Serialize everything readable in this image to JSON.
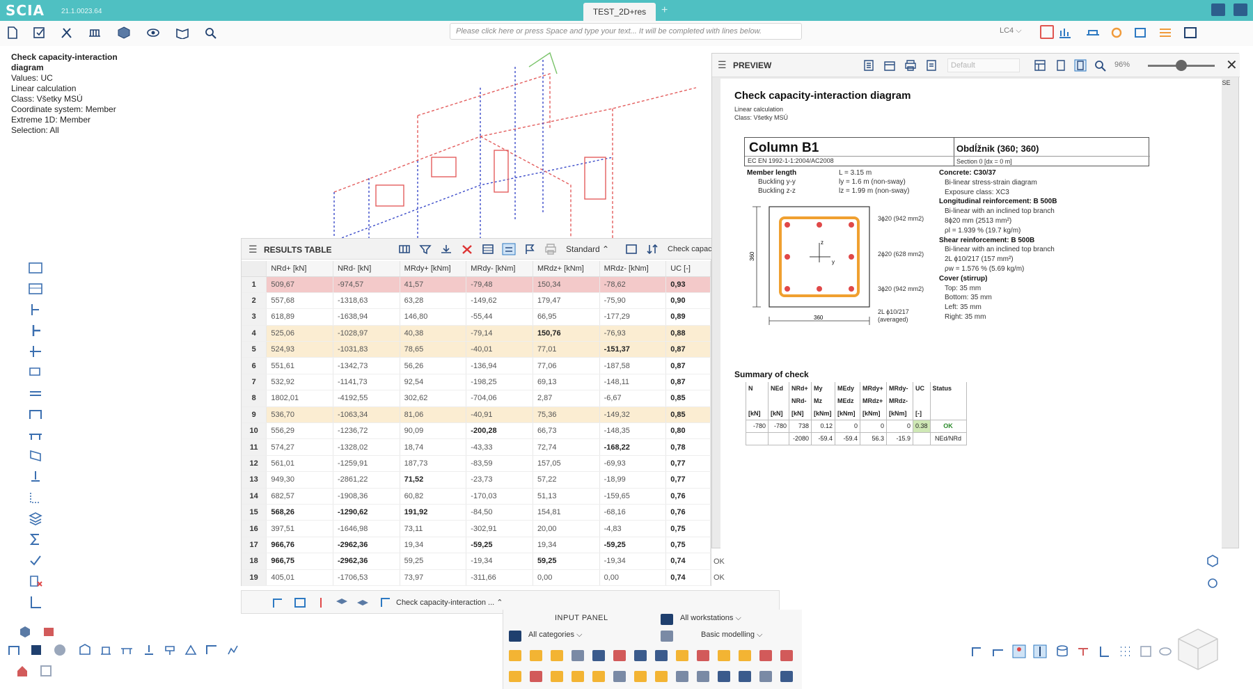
{
  "app": {
    "name": "SCIA",
    "version": "21.1.0023.64",
    "tab": "TEST_2D+res",
    "add_tab": "+"
  },
  "toolbar": {
    "command_placeholder": "Please click here or press Space and type your text... It will be completed with lines below.",
    "load_case": "LC4"
  },
  "info": {
    "title": "Check capacity-interaction diagram",
    "lines": [
      "Values: UC",
      "Linear calculation",
      "Class: Všetky MSÚ",
      "Coordinate system: Member",
      "Extreme 1D: Member",
      "Selection: All"
    ]
  },
  "results": {
    "title": "RESULTS TABLE",
    "view": "Standard",
    "check_label": "Check capacit",
    "columns": [
      "NRd+ [kN]",
      "NRd- [kN]",
      "MRdy+ [kNm]",
      "MRdy- [kNm]",
      "MRdz+ [kNm]",
      "MRdz- [kNm]",
      "UC [-]"
    ],
    "rows": [
      {
        "n": "1",
        "v": [
          "509,67",
          "-974,57",
          "41,57",
          "-79,48",
          "150,34",
          "-78,62",
          "0,93"
        ],
        "s": "",
        "state": "sel"
      },
      {
        "n": "2",
        "v": [
          "557,68",
          "-1318,63",
          "63,28",
          "-149,62",
          "179,47",
          "-75,90",
          "0,90"
        ],
        "s": "",
        "state": ""
      },
      {
        "n": "3",
        "v": [
          "618,89",
          "-1638,94",
          "146,80",
          "-55,44",
          "66,95",
          "-177,29",
          "0,89"
        ],
        "s": "",
        "state": ""
      },
      {
        "n": "4",
        "v": [
          "525,06",
          "-1028,97",
          "40,38",
          "-79,14",
          "150,76",
          "-76,93",
          "0,88"
        ],
        "s": "",
        "state": "hl"
      },
      {
        "n": "5",
        "v": [
          "524,93",
          "-1031,83",
          "78,65",
          "-40,01",
          "77,01",
          "-151,37",
          "0,87"
        ],
        "s": "",
        "state": "hl"
      },
      {
        "n": "6",
        "v": [
          "551,61",
          "-1342,73",
          "56,26",
          "-136,94",
          "77,06",
          "-187,58",
          "0,87"
        ],
        "s": "",
        "state": ""
      },
      {
        "n": "7",
        "v": [
          "532,92",
          "-1141,73",
          "92,54",
          "-198,25",
          "69,13",
          "-148,11",
          "0,87"
        ],
        "s": "",
        "state": ""
      },
      {
        "n": "8",
        "v": [
          "1802,01",
          "-4192,55",
          "302,62",
          "-704,06",
          "2,87",
          "-6,67",
          "0,85"
        ],
        "s": "",
        "state": ""
      },
      {
        "n": "9",
        "v": [
          "536,70",
          "-1063,34",
          "81,06",
          "-40,91",
          "75,36",
          "-149,32",
          "0,85"
        ],
        "s": "",
        "state": "hl"
      },
      {
        "n": "10",
        "v": [
          "556,29",
          "-1236,72",
          "90,09",
          "-200,28",
          "66,73",
          "-148,35",
          "0,80"
        ],
        "s": "",
        "state": ""
      },
      {
        "n": "11",
        "v": [
          "574,27",
          "-1328,02",
          "18,74",
          "-43,33",
          "72,74",
          "-168,22",
          "0,78"
        ],
        "s": "",
        "state": ""
      },
      {
        "n": "12",
        "v": [
          "561,01",
          "-1259,91",
          "187,73",
          "-83,59",
          "157,05",
          "-69,93",
          "0,77"
        ],
        "s": "",
        "state": ""
      },
      {
        "n": "13",
        "v": [
          "949,30",
          "-2861,22",
          "71,52",
          "-23,73",
          "57,22",
          "-18,99",
          "0,77"
        ],
        "s": "",
        "state": ""
      },
      {
        "n": "14",
        "v": [
          "682,57",
          "-1908,36",
          "60,82",
          "-170,03",
          "51,13",
          "-159,65",
          "0,76"
        ],
        "s": "",
        "state": ""
      },
      {
        "n": "15",
        "v": [
          "568,26",
          "-1290,62",
          "191,92",
          "-84,50",
          "154,81",
          "-68,16",
          "0,76"
        ],
        "s": "",
        "state": ""
      },
      {
        "n": "16",
        "v": [
          "397,51",
          "-1646,98",
          "73,11",
          "-302,91",
          "20,00",
          "-4,83",
          "0,75"
        ],
        "s": "",
        "state": ""
      },
      {
        "n": "17",
        "v": [
          "966,76",
          "-2962,36",
          "19,34",
          "-59,25",
          "19,34",
          "-59,25",
          "0,75"
        ],
        "s": "",
        "state": ""
      },
      {
        "n": "18",
        "v": [
          "966,75",
          "-2962,36",
          "59,25",
          "-19,34",
          "59,25",
          "-19,34",
          "0,74"
        ],
        "s": "OK",
        "state": ""
      },
      {
        "n": "19",
        "v": [
          "405,01",
          "-1706,53",
          "73,97",
          "-311,66",
          "0,00",
          "0,00",
          "0,74"
        ],
        "s": "OK",
        "state": ""
      }
    ]
  },
  "bottom_tab": {
    "label": "Check capacity-interaction ..."
  },
  "input_panel": {
    "title": "INPUT PANEL",
    "workstations": "All workstations",
    "categories": "All categories",
    "modelling": "Basic modelling"
  },
  "preview": {
    "title": "PREVIEW",
    "style": "Default",
    "zoom": "96%",
    "zoom_fraction": 0.5,
    "close_label": "CLOSE",
    "doc": {
      "title": "Check capacity-interaction diagram",
      "sub1": "Linear calculation",
      "sub2": "Class: Všetky MSÚ",
      "column": "Column B1",
      "standard": "EC EN 1992-1-1:2004/AC2008",
      "shape": "Obdĺžnik (360; 360)",
      "section": "Section 0 [dx = 0 m]",
      "member_length_label": "Member length",
      "member_length": "L = 3.15 m",
      "buckling_y_label": "Buckling y-y",
      "buckling_y": "ly = 1.6 m (non-sway)",
      "buckling_z_label": "Buckling z-z",
      "buckling_z": "lz = 1.99 m (non-sway)",
      "dim_h": "360",
      "dim_w": "360",
      "bar_top": "3ϕ20 (942 mm2)",
      "bar_mid": "2ϕ20 (628 mm2)",
      "bar_bot": "3ϕ20 (942 mm2)",
      "stirrup1": "2L ϕ10/217",
      "stirrup2": "(averaged)",
      "axis_z": "z",
      "axis_y": "y",
      "props": [
        {
          "t": "Concrete: C30/37",
          "b": true
        },
        {
          "t": "Bi-linear stress-strain diagram",
          "b": false
        },
        {
          "t": "Exposure class: XC3",
          "b": false
        },
        {
          "t": "Longitudinal reinforcement: B 500B",
          "b": true
        },
        {
          "t": "Bi-linear with an inclined top branch",
          "b": false
        },
        {
          "t": "8ϕ20 mm (2513 mm²)",
          "b": false
        },
        {
          "t": "ρl = 1.939 % (19.7 kg/m)",
          "b": false
        },
        {
          "t": "Shear reinforcement: B 500B",
          "b": true
        },
        {
          "t": "Bi-linear with an inclined top branch",
          "b": false
        },
        {
          "t": "2L ϕ10/217 (157 mm²)",
          "b": false
        },
        {
          "t": "ρw = 1.576 % (5.69 kg/m)",
          "b": false
        },
        {
          "t": "Cover (stirrup)",
          "b": true
        },
        {
          "t": "Top: 35 mm",
          "b": false
        },
        {
          "t": "Bottom: 35 mm",
          "b": false
        },
        {
          "t": "Left: 35 mm",
          "b": false
        },
        {
          "t": "Right: 35 mm",
          "b": false
        }
      ],
      "summary_title": "Summary of check",
      "sum_head1": [
        "N",
        "NEd",
        "NRd+",
        "My",
        "MEdy",
        "MRdy+",
        "MRdy-",
        "UC",
        "Status"
      ],
      "sum_head2": [
        "",
        "",
        "NRd-",
        "Mz",
        "MEdz",
        "MRdz+",
        "MRdz-",
        "",
        ""
      ],
      "sum_units": [
        "[kN]",
        "[kN]",
        "[kN]",
        "[kNm]",
        "[kNm]",
        "[kNm]",
        "[kNm]",
        "[-]",
        ""
      ],
      "sum_row1": [
        "-780",
        "-780",
        "738",
        "0.12",
        "0",
        "0",
        "0",
        "0.38",
        "OK"
      ],
      "sum_row2": [
        "",
        "",
        "-2080",
        "-59.4",
        "-59.4",
        "56.3",
        "-15.9",
        "",
        "NEd/NRd"
      ]
    }
  }
}
